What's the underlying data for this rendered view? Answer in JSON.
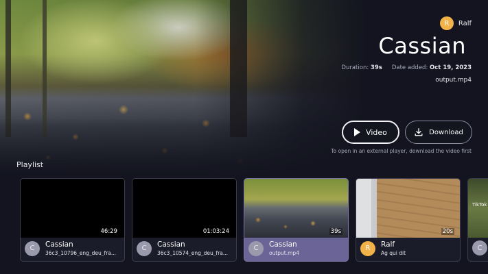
{
  "header": {
    "author_initial": "R",
    "author_name": "Ralf",
    "title": "Cassian",
    "duration_label": "Duration:",
    "duration_value": "39s",
    "date_label": "Date added:",
    "date_value": "Oct 19, 2023",
    "filename": "output.mp4"
  },
  "actions": {
    "video_label": "Video",
    "download_label": "Download",
    "hint": "To open in an external player, download the video first"
  },
  "playlist": {
    "label": "Playlist",
    "items": [
      {
        "initial": "C",
        "title": "Cassian",
        "subtitle": "36c3_10796_eng_deu_fra...",
        "duration": "46:29",
        "active": false
      },
      {
        "initial": "C",
        "title": "Cassian",
        "subtitle": "36c3_10574_eng_deu_fra...",
        "duration": "01:03:24",
        "active": false
      },
      {
        "initial": "C",
        "title": "Cassian",
        "subtitle": "output.mp4",
        "duration": "39s",
        "active": true
      },
      {
        "initial": "R",
        "title": "Ralf",
        "subtitle": "Ag qui dit",
        "duration": "20s",
        "active": false
      },
      {
        "initial": "C",
        "title": "",
        "subtitle": "",
        "duration": "",
        "active": false,
        "badge": "TikTok"
      }
    ]
  },
  "colors": {
    "background": "#13141f",
    "active_card": "#6b6597",
    "avatar_orange": "#f1b24a",
    "avatar_gray": "#9a9aac"
  }
}
